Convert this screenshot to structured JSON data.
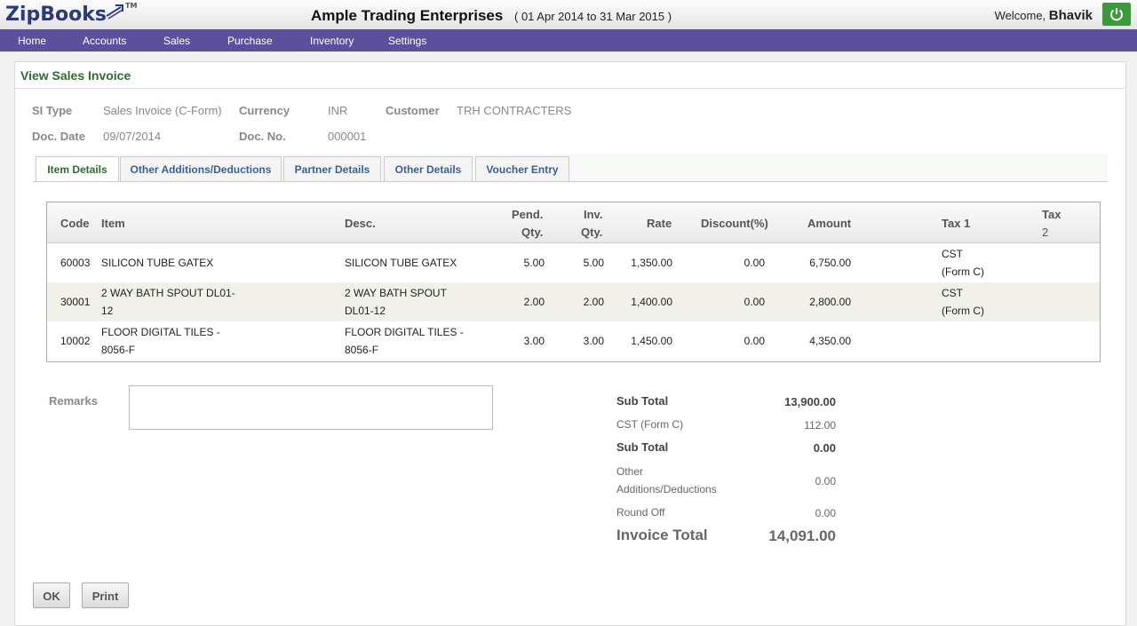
{
  "header": {
    "logo": "ZipBooks",
    "logo_tm": "TM",
    "company": "Ample Trading Enterprises",
    "period": "( 01 Apr 2014 to 31 Mar 2015 )",
    "welcome": "Welcome,",
    "user": "Bhavik",
    "power_icon": "power-icon",
    "brand_green": "#3c9a3c",
    "nav_color": "#5d4f9c"
  },
  "nav": [
    "Home",
    "Accounts",
    "Sales",
    "Purchase",
    "Inventory",
    "Settings"
  ],
  "page": {
    "title": "View Sales Invoice",
    "fields": {
      "si_type_label": "SI Type",
      "si_type": "Sales Invoice (C-Form)",
      "currency_label": "Currency",
      "currency": "INR",
      "customer_label": "Customer",
      "customer": "TRH CONTRACTERS",
      "doc_date_label": "Doc. Date",
      "doc_date": "09/07/2014",
      "doc_no_label": "Doc. No.",
      "doc_no": "000001"
    },
    "tabs": [
      "Item Details",
      "Other Additions/Deductions",
      "Partner Details",
      "Other Details",
      "Voucher Entry"
    ],
    "active_tab": "Item Details"
  },
  "table": {
    "headers": {
      "code": "Code",
      "item": "Item",
      "desc": "Desc.",
      "pend_qty_1": "Pend.",
      "pend_qty_2": "Qty.",
      "inv_qty_1": "Inv.",
      "inv_qty_2": "Qty.",
      "rate": "Rate",
      "discount": "Discount(%)",
      "amount": "Amount",
      "tax1": "Tax 1",
      "tax2_1": "Tax",
      "tax2_2": "2"
    },
    "rows": [
      {
        "code": "60003",
        "item1": "SILICON TUBE GATEX",
        "item2": "",
        "desc1": "SILICON TUBE GATEX",
        "desc2": "",
        "pend": "5.00",
        "inv": "5.00",
        "rate": "1,350.00",
        "disc": "0.00",
        "amount": "6,750.00",
        "tax1a": "CST",
        "tax1b": "(Form C)"
      },
      {
        "code": "30001",
        "item1": "2 WAY BATH SPOUT DL01-",
        "item2": "12",
        "desc1": "2 WAY BATH SPOUT",
        "desc2": "DL01-12",
        "pend": "2.00",
        "inv": "2.00",
        "rate": "1,400.00",
        "disc": "0.00",
        "amount": "2,800.00",
        "tax1a": "CST",
        "tax1b": "(Form C)"
      },
      {
        "code": "10002",
        "item1": "FLOOR DIGITAL TILES -",
        "item2": "8056-F",
        "desc1": "FLOOR DIGITAL TILES -",
        "desc2": "8056-F",
        "pend": "3.00",
        "inv": "3.00",
        "rate": "1,450.00",
        "disc": "0.00",
        "amount": "4,350.00",
        "tax1a": "",
        "tax1b": ""
      }
    ]
  },
  "remarks": {
    "label": "Remarks",
    "value": ""
  },
  "totals": {
    "sub_total_label": "Sub Total",
    "sub_total": "13,900.00",
    "cst_label": "CST (Form C)",
    "cst": "112.00",
    "sub_total2_label": "Sub Total",
    "sub_total2": "0.00",
    "other_label_1": "Other",
    "other_label_2": "Additions/Deductions",
    "other": "0.00",
    "round_off_label": "Round Off",
    "round_off": "0.00",
    "invoice_total_label": "Invoice Total",
    "invoice_total": "14,091.00"
  },
  "buttons": {
    "ok": "OK",
    "print": "Print"
  }
}
